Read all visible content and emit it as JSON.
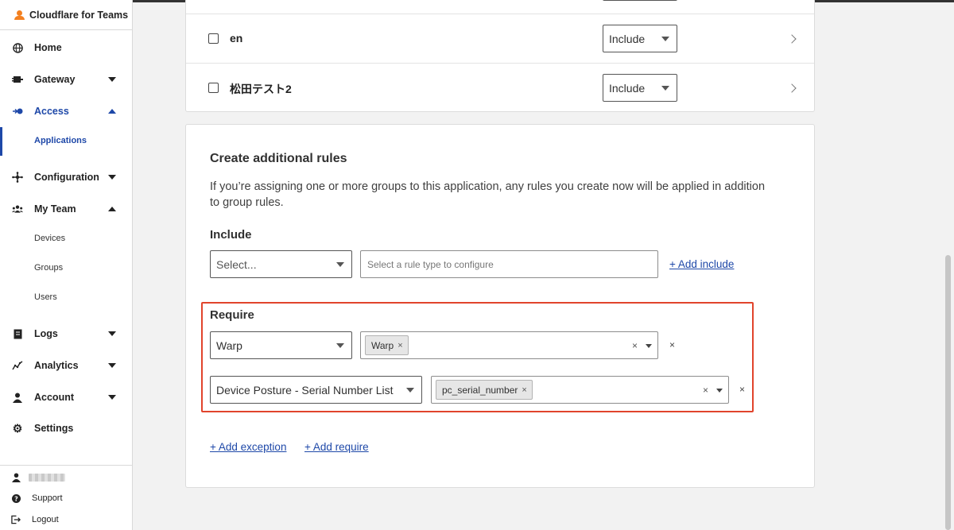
{
  "app": {
    "brand": "Cloudflare for Teams"
  },
  "sidebar": {
    "items": [
      {
        "label": "Home",
        "icon": "globe-icon"
      },
      {
        "label": "Gateway",
        "icon": "gateway-icon"
      },
      {
        "label": "Access",
        "icon": "access-icon"
      },
      {
        "label": "Configuration",
        "icon": "configuration-icon"
      },
      {
        "label": "My Team",
        "icon": "team-icon"
      },
      {
        "label": "Logs",
        "icon": "logs-icon"
      },
      {
        "label": "Analytics",
        "icon": "analytics-icon"
      },
      {
        "label": "Account",
        "icon": "account-icon"
      },
      {
        "label": "Settings",
        "icon": "gear-icon"
      }
    ],
    "access_sub": [
      "Applications"
    ],
    "team_sub": [
      "Devices",
      "Groups",
      "Users"
    ],
    "footer": {
      "support": "Support",
      "logout": "Logout"
    }
  },
  "groups": {
    "rows": [
      {
        "name": "en",
        "action": "Include"
      },
      {
        "name": "松田テスト2",
        "action": "Include"
      }
    ]
  },
  "rules": {
    "title": "Create additional rules",
    "description_line1": "If you’re assigning one or more groups to this application, any rules you create now will be applied in addition",
    "description_line2": "to group rules.",
    "include": {
      "label": "Include",
      "select_placeholder": "Select...",
      "value_placeholder": "Select a rule type to configure",
      "add_link": "+ Add include"
    },
    "require": {
      "label": "Require",
      "rows": [
        {
          "type": "Warp",
          "tag": "Warp"
        },
        {
          "type": "Device Posture - Serial Number List",
          "tag": "pc_serial_number"
        }
      ]
    },
    "add_exception": "+ Add exception",
    "add_require": "+ Add require"
  },
  "colors": {
    "accent": "#1e48a8",
    "highlight": "#e1442c",
    "brand": "#f38020"
  }
}
